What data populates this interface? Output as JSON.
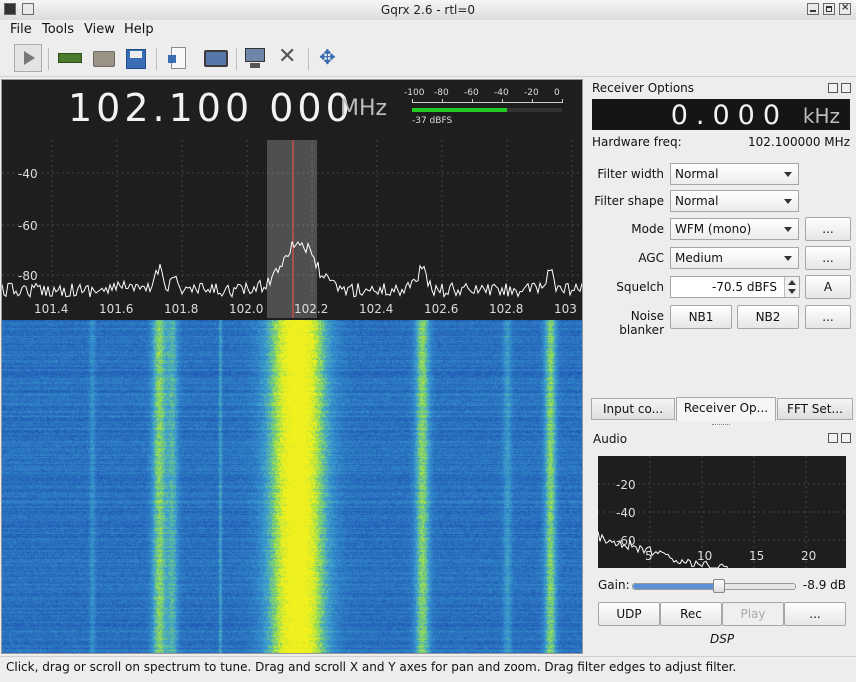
{
  "window": {
    "title": "Gqrx 2.6 - rtl=0"
  },
  "menu": {
    "file": "File",
    "tools": "Tools",
    "view": "View",
    "help": "Help"
  },
  "main": {
    "frequency_display": "102.100 000",
    "frequency_unit": "MHz",
    "smeter": {
      "ticks": [
        "-100",
        "-80",
        "-60",
        "-40",
        "-20",
        "0"
      ],
      "level_text": "-37 dBFS",
      "level_fraction": 0.63
    },
    "spectrum": {
      "y_ticks": [
        "-40",
        "-60",
        "-80"
      ],
      "x_ticks": [
        "101.4",
        "101.6",
        "101.8",
        "102.0",
        "102.2",
        "102.4",
        "102.6",
        "102.8",
        "103"
      ]
    }
  },
  "receiver": {
    "title": "Receiver Options",
    "offset_value": "0.000",
    "offset_unit": "kHz",
    "hw_freq_label": "Hardware freq:",
    "hw_freq_value": "102.100000 MHz",
    "filter_width_label": "Filter width",
    "filter_width_value": "Normal",
    "filter_shape_label": "Filter shape",
    "filter_shape_value": "Normal",
    "mode_label": "Mode",
    "mode_value": "WFM (mono)",
    "agc_label": "AGC",
    "agc_value": "Medium",
    "squelch_label": "Squelch",
    "squelch_value": "-70.5 dBFS",
    "squelch_auto": "A",
    "noise_blanker_label": "Noise blanker",
    "nb1": "NB1",
    "nb2": "NB2",
    "more": "..."
  },
  "tabs": {
    "input": "Input co...",
    "receiver": "Receiver Op...",
    "fft": "FFT Set..."
  },
  "audio": {
    "title": "Audio",
    "y_ticks": [
      "-20",
      "-40",
      "-60"
    ],
    "x_ticks": [
      "5",
      "10",
      "15",
      "20"
    ],
    "gain_label": "Gain:",
    "gain_value": "-8.9 dB",
    "gain_fraction": 0.54,
    "udp": "UDP",
    "rec": "Rec",
    "play": "Play",
    "more": "...",
    "dsp_label": "DSP"
  },
  "status": {
    "text": "Click, drag or scroll on spectrum to tune. Drag and scroll X and Y axes for pan and zoom. Drag filter edges to adjust filter."
  }
}
